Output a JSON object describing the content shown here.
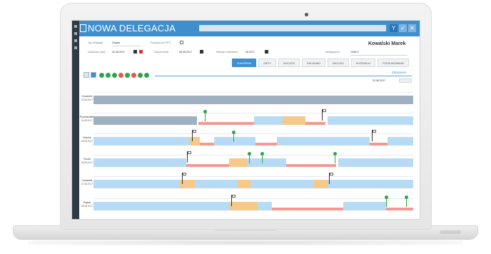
{
  "app": {
    "title": "NOWA DELEGACJA",
    "user_name": "Kowalski Marek"
  },
  "toolbar_buttons": [
    "Y",
    "✓",
    "✕"
  ],
  "form": {
    "typ_label": "Typ delegacji",
    "typ_value": "Zwykła",
    "pozycja_label": "Pozycja doc GPS",
    "data_label": "Data/czas wydl.",
    "data_value": "02.08.2017",
    "zakonczenie_label": "Zakończenie",
    "zakonczenie_value": "08.08.2017",
    "miesiac_label": "Miesiąc rozliczenia",
    "miesiac_value": "08.2017",
    "delegacja_label": "Delegacja nr",
    "delegacja_value": "1/08/17"
  },
  "tabs": [
    {
      "label": "ZDARZENIA",
      "active": true
    },
    {
      "label": "DIETY",
      "active": false
    },
    {
      "label": "NOCLEGI",
      "active": false
    },
    {
      "label": "RACHUNKI",
      "active": false
    },
    {
      "label": "ZALICZKI",
      "active": false
    },
    {
      "label": "WYDRUKUJ",
      "active": false
    },
    {
      "label": "PODSUMOWANIE",
      "active": false
    }
  ],
  "timeline": {
    "header_link": "Zdarzenia",
    "current_date": "02.08.2017",
    "colors": {
      "grey": "#9fb1c1",
      "blue": "#b8dbf5",
      "orange": "#f5c98a",
      "red": "#f29a92",
      "accent": "#3f8fcf"
    },
    "rows": [
      {
        "day": "Czwartek",
        "date": "03.08.2017"
      },
      {
        "day": "Poniedziałek",
        "date": "04.08.2017"
      },
      {
        "day": "Wtorek",
        "date": "05.08.2017"
      },
      {
        "day": "Środa",
        "date": "06.08.2017"
      },
      {
        "day": "Czwartek",
        "date": "07.08.2017"
      },
      {
        "day": "Piątek",
        "date": "08.08.2017"
      }
    ]
  }
}
